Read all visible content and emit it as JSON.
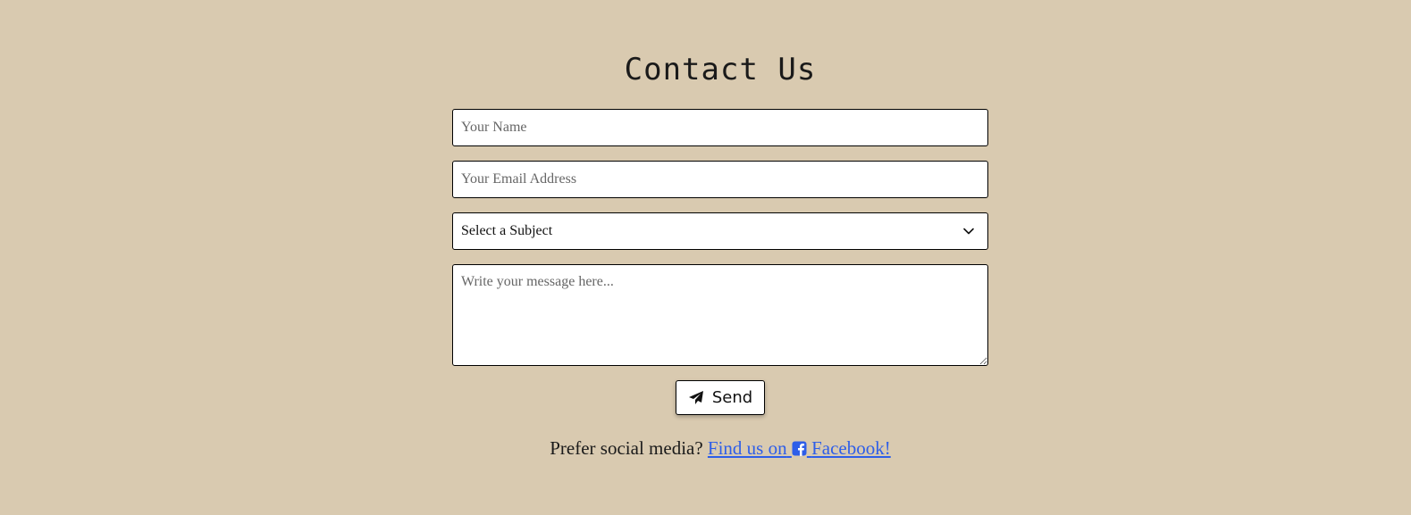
{
  "contact": {
    "title": "Contact Us",
    "name_placeholder": "Your Name",
    "email_placeholder": "Your Email Address",
    "subject_selected": "Select a Subject",
    "message_placeholder": "Write your message here...",
    "send_label": "Send",
    "social_prompt": "Prefer social media?",
    "social_link_prefix": "Find us on",
    "social_link_suffix": "Facebook!"
  },
  "icons": {
    "send": "paper-plane-icon",
    "social": "facebook-square-icon",
    "select": "chevron-down-icon"
  },
  "colors": {
    "background": "#d9cab0",
    "link": "#2e5ee8",
    "border": "#000000"
  }
}
